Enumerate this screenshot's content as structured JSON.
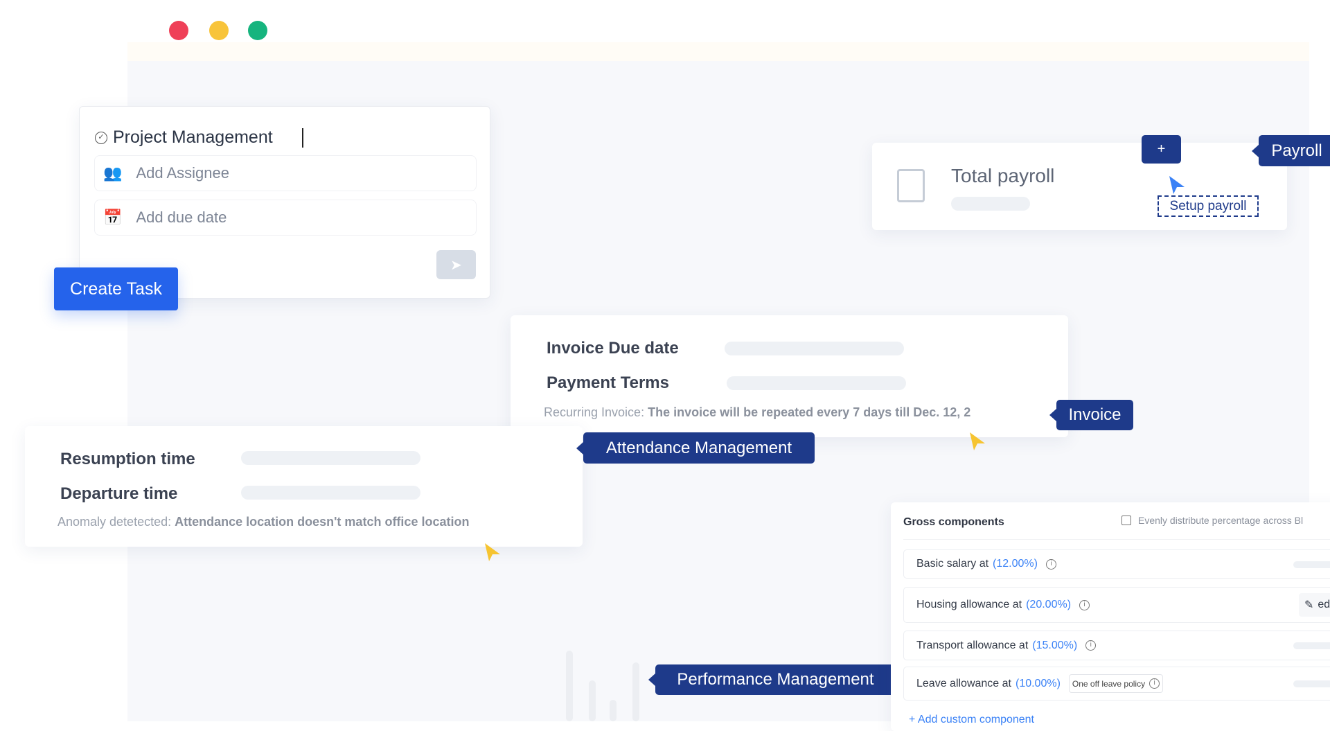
{
  "window": {
    "controls": [
      {
        "name": "close",
        "color": "#ef4058"
      },
      {
        "name": "minimize",
        "color": "#f8c43a"
      },
      {
        "name": "maximize",
        "color": "#16b47e"
      }
    ]
  },
  "task": {
    "title": "Project Management",
    "assignee_placeholder": "Add Assignee",
    "due_placeholder": "Add due date",
    "create_label": "Create Task"
  },
  "payroll": {
    "title": "Total payroll",
    "setup_label": "Setup payroll",
    "add_label": "+",
    "tag": "Payroll"
  },
  "invoice": {
    "due_label": "Invoice Due date",
    "terms_label": "Payment Terms",
    "recurring_prefix": "Recurring Invoice:",
    "recurring_text": "The invoice will be repeated every 7 days till Dec. 12, 2",
    "tag": "Invoice"
  },
  "attendance": {
    "resumption_label": "Resumption time",
    "departure_label": "Departure time",
    "anomaly_prefix": "Anomaly detetected:",
    "anomaly_text": "Attendance location doesn't match office location",
    "tag": "Attendance Management"
  },
  "performance": {
    "tag": "Performance Management"
  },
  "gross": {
    "title": "Gross components",
    "evenly_label": "Evenly distribute percentage across Bl",
    "rows": [
      {
        "label": "Basic salary at",
        "pct": "(12.00%)"
      },
      {
        "label": "Housing allowance at",
        "pct": "(20.00%)",
        "action": "ed"
      },
      {
        "label": "Transport allowance at",
        "pct": "(15.00%)"
      },
      {
        "label": "Leave allowance at",
        "pct": "(10.00%)",
        "badge": "One off leave policy"
      }
    ],
    "add_label": "+ Add custom component"
  },
  "colors": {
    "accent": "#2563eb",
    "tag": "#1e3a8a",
    "cursor_yellow": "#f6c431",
    "cursor_blue": "#3b82f6"
  }
}
